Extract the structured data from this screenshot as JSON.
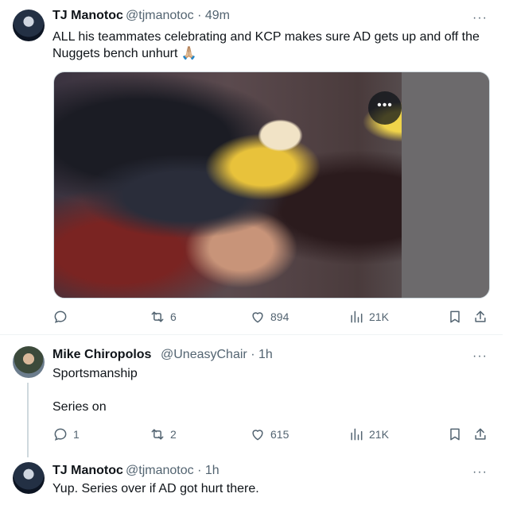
{
  "tweets": [
    {
      "name": "TJ Manotoc",
      "handle": "@tjmanotoc",
      "separator": "·",
      "time": "49m",
      "text": "ALL his teammates celebrating and KCP makes sure AD gets up and off the Nuggets bench unhurt 🙏🏼",
      "has_media": true,
      "more": "···",
      "media_more": "•••",
      "actions": {
        "reply": "",
        "retweet": "6",
        "like": "894",
        "views": "21K"
      }
    },
    {
      "name": "Mike Chiropolos",
      "handle": "@UneasyChair",
      "separator": "·",
      "time": "1h",
      "text_line1": "Sportsmanship",
      "text_line2": "Series on",
      "more": "···",
      "actions": {
        "reply": "1",
        "retweet": "2",
        "like": "615",
        "views": "21K"
      }
    },
    {
      "name": "TJ Manotoc",
      "handle": "@tjmanotoc",
      "separator": "·",
      "time": "1h",
      "text": "Yup. Series over if AD got hurt there.",
      "more": "···"
    }
  ],
  "colors": {
    "text": "#0f1419",
    "muted": "#536471",
    "divider": "#eff3f4"
  },
  "icons": [
    "reply-icon",
    "retweet-icon",
    "like-icon",
    "views-icon",
    "bookmark-icon",
    "share-icon",
    "more-icon"
  ]
}
